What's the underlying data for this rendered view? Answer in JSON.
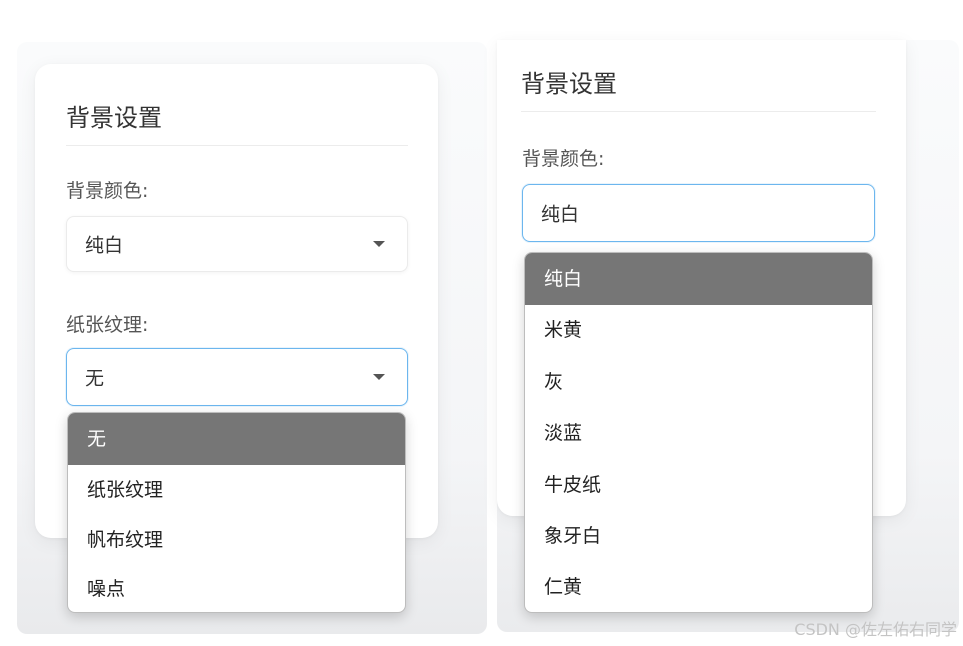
{
  "left_panel": {
    "title": "背景设置",
    "bg_color_label": "背景颜色:",
    "bg_color_value": "纯白",
    "texture_label": "纸张纹理:",
    "texture_value": "无",
    "texture_options": [
      "无",
      "纸张纹理",
      "帆布纹理",
      "噪点"
    ],
    "texture_selected_index": 0
  },
  "right_panel": {
    "title": "背景设置",
    "bg_color_label": "背景颜色:",
    "bg_color_value": "纯白",
    "color_options": [
      "纯白",
      "米黄",
      "灰",
      "淡蓝",
      "牛皮纸",
      "象牙白",
      "仁黄"
    ],
    "color_selected_index": 0
  },
  "watermark": "CSDN @佐左佑右同学",
  "colors": {
    "focus_border": "#6cb6ee",
    "selected_option_bg": "#767676"
  },
  "icons": {
    "dropdown_caret": "caret-down-icon"
  }
}
